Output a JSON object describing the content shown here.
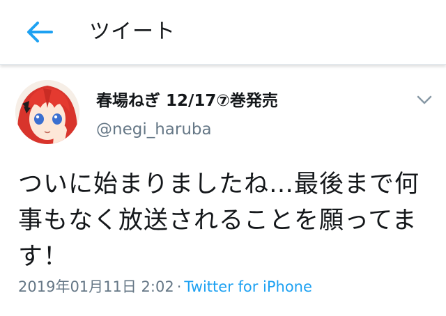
{
  "header": {
    "title": "ツイート",
    "back_icon": "arrow-left-icon",
    "accent_color": "#1da1f2"
  },
  "tweet": {
    "author": {
      "name": "春場ねぎ 12/17⑦巻発売",
      "handle": "@negi_haruba"
    },
    "caret_icon": "chevron-down-icon",
    "text": "ついに始まりましたね…最後まで何事もなく放送されることを願ってます！",
    "timestamp": "2019年01月11日 2:02",
    "separator": "·",
    "source": "Twitter for iPhone"
  }
}
